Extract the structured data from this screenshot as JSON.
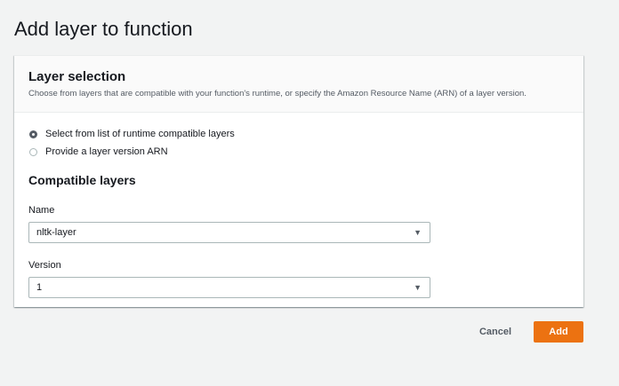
{
  "page": {
    "title": "Add layer to function"
  },
  "layer_selection": {
    "title": "Layer selection",
    "description": "Choose from layers that are compatible with your function's runtime, or specify the Amazon Resource Name (ARN) of a layer version.",
    "options": [
      {
        "label": "Select from list of runtime compatible layers",
        "checked": true
      },
      {
        "label": "Provide a layer version ARN",
        "checked": false
      }
    ]
  },
  "compatible_layers": {
    "title": "Compatible layers",
    "name_label": "Name",
    "name_value": "nltk-layer",
    "version_label": "Version",
    "version_value": "1",
    "caret_icon": "caret-down-icon"
  },
  "actions": {
    "cancel_label": "Cancel",
    "add_label": "Add",
    "add_color": "#ec7211"
  }
}
